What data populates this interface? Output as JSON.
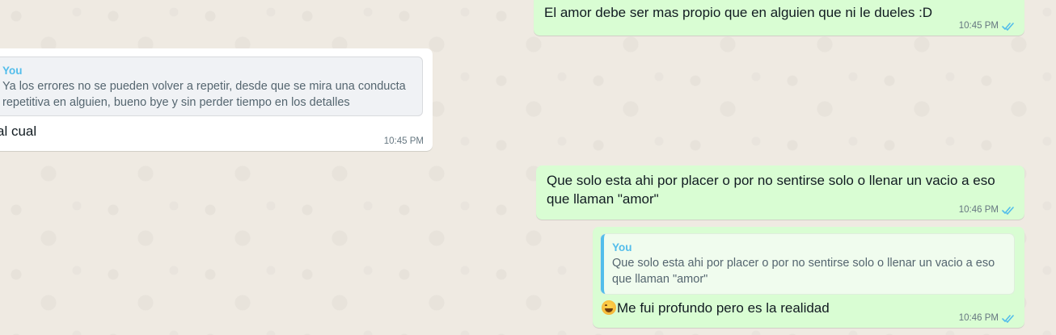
{
  "messages": [
    {
      "direction": "outgoing",
      "text": "El amor debe ser mas propio que en alguien que ni le dueles :D",
      "time": "10:45 PM",
      "status": "read"
    },
    {
      "direction": "incoming",
      "quote": {
        "author": "You",
        "text_line1": "Ya los errores no se pueden volver a repetir, desde que se mira una conducta",
        "text_line2": "repetitiva en alguien, bueno bye y sin perder tiempo en los detalles"
      },
      "text": "al cual",
      "time": "10:45 PM"
    },
    {
      "direction": "outgoing",
      "text_line1": "Que solo esta ahi por placer o por no sentirse solo o llenar un vacio a eso",
      "text_line2": "que llaman \"amor\"",
      "time": "10:46 PM",
      "status": "read"
    },
    {
      "direction": "outgoing",
      "quote": {
        "author": "You",
        "text_line1": "Que solo esta ahi por placer o por no sentirse solo o llenar un vacio a eso",
        "text_line2": "que llaman \"amor\""
      },
      "emoji": "face-with-tears-of-joy",
      "text": "Me fui profundo pero es la realidad",
      "time": "10:46 PM",
      "status": "read"
    }
  ],
  "colors": {
    "chat_background": "#efeae2",
    "outgoing_bubble": "#d9fdd3",
    "incoming_bubble": "#ffffff",
    "read_ticks": "#53bdeb",
    "quote_author": "#53bdeb"
  }
}
